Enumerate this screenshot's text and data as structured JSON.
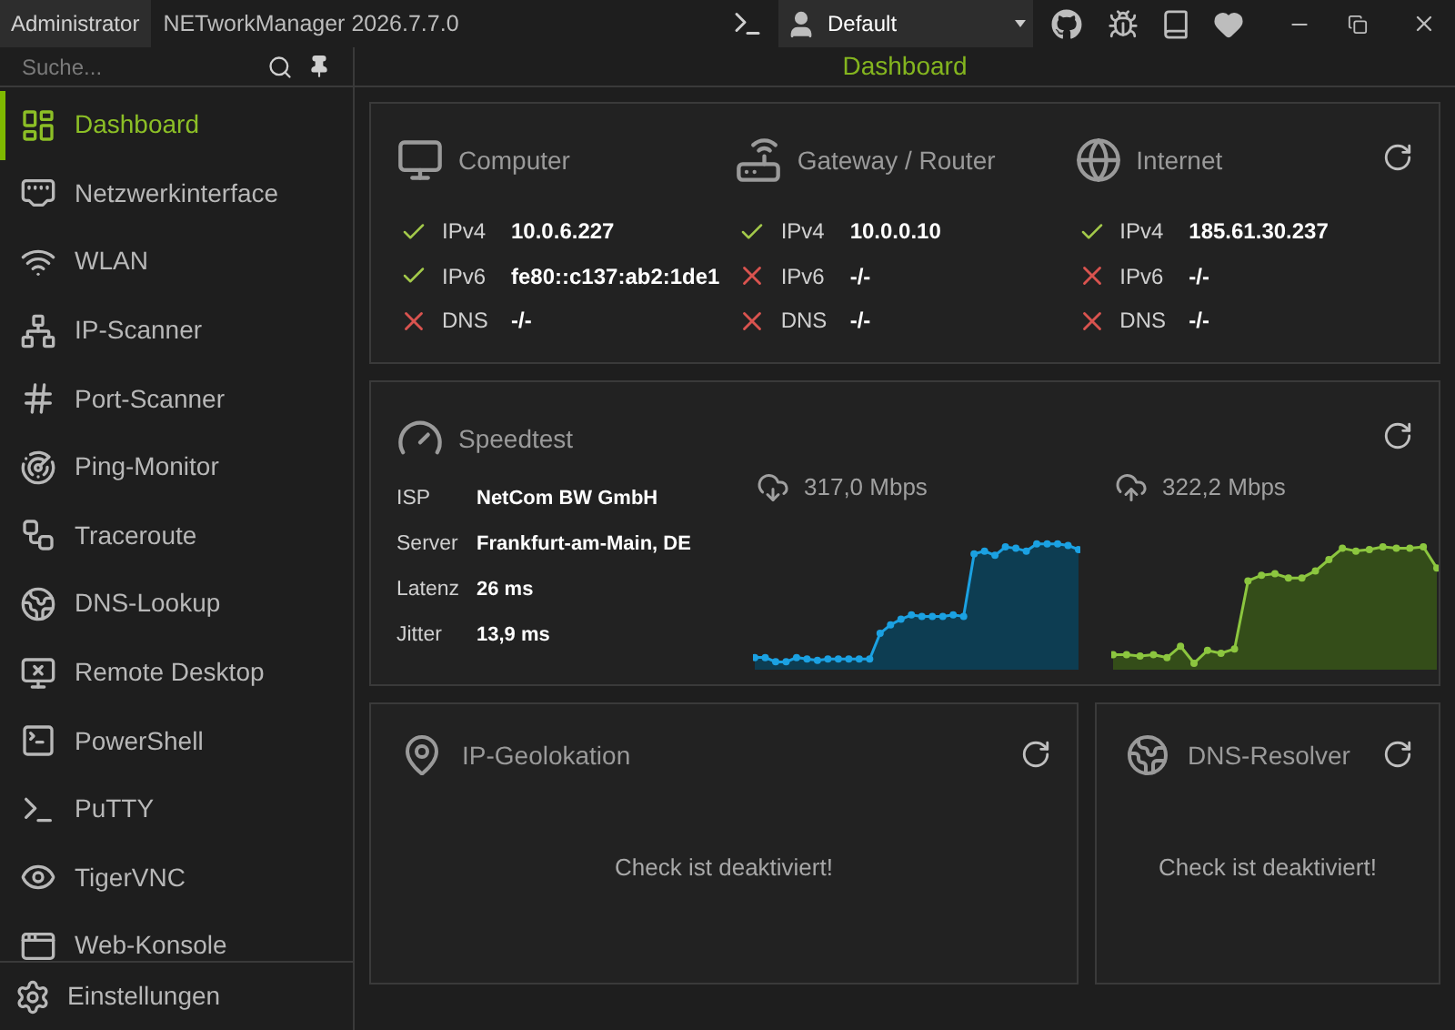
{
  "title_bar": {
    "user": "Administrator",
    "title": "NETworkManager 2026.7.7.0",
    "profile": "Default"
  },
  "sidebar": {
    "search": {
      "placeholder": "Suche..."
    },
    "items": [
      {
        "label": "Dashboard",
        "selected": true
      },
      {
        "label": "Netzwerkinterface",
        "selected": false
      },
      {
        "label": "WLAN",
        "selected": false
      },
      {
        "label": "IP-Scanner",
        "selected": false
      },
      {
        "label": "Port-Scanner",
        "selected": false
      },
      {
        "label": "Ping-Monitor",
        "selected": false
      },
      {
        "label": "Traceroute",
        "selected": false
      },
      {
        "label": "DNS-Lookup",
        "selected": false
      },
      {
        "label": "Remote Desktop",
        "selected": false
      },
      {
        "label": "PowerShell",
        "selected": false
      },
      {
        "label": "PuTTY",
        "selected": false
      },
      {
        "label": "TigerVNC",
        "selected": false
      },
      {
        "label": "Web-Konsole",
        "selected": false
      }
    ],
    "settings": "Einstellungen"
  },
  "page_title": "Dashboard",
  "status": {
    "columns": [
      {
        "title": "Computer",
        "kind": "computer",
        "rows": [
          {
            "label": "IPv4",
            "value": "10.0.6.227",
            "ok": true
          },
          {
            "label": "IPv6",
            "value": "fe80::c137:ab2:1de1",
            "ok": true
          },
          {
            "label": "DNS",
            "value": "-/-",
            "ok": false
          }
        ]
      },
      {
        "title": "Gateway / Router",
        "kind": "router",
        "rows": [
          {
            "label": "IPv4",
            "value": "10.0.0.10",
            "ok": true
          },
          {
            "label": "IPv6",
            "value": "-/-",
            "ok": false
          },
          {
            "label": "DNS",
            "value": "-/-",
            "ok": false
          }
        ]
      },
      {
        "title": "Internet",
        "kind": "internet",
        "rows": [
          {
            "label": "IPv4",
            "value": "185.61.30.237",
            "ok": true
          },
          {
            "label": "IPv6",
            "value": "-/-",
            "ok": false
          },
          {
            "label": "DNS",
            "value": "-/-",
            "ok": false
          }
        ]
      }
    ]
  },
  "speedtest": {
    "title": "Speedtest",
    "info": [
      {
        "label": "ISP",
        "value": "NetCom BW GmbH"
      },
      {
        "label": "Server",
        "value": "Frankfurt-am-Main, DE"
      },
      {
        "label": "Latenz",
        "value": "26 ms"
      },
      {
        "label": "Jitter",
        "value": "13,9 ms"
      }
    ],
    "download": "317,0 Mbps",
    "upload": "322,2 Mbps"
  },
  "bottom_cards": [
    {
      "title": "IP-Geolokation",
      "kind": "geo",
      "message": "Check ist deaktiviert!"
    },
    {
      "title": "DNS-Resolver",
      "kind": "dns",
      "message": "Check ist deaktiviert!"
    }
  ]
}
